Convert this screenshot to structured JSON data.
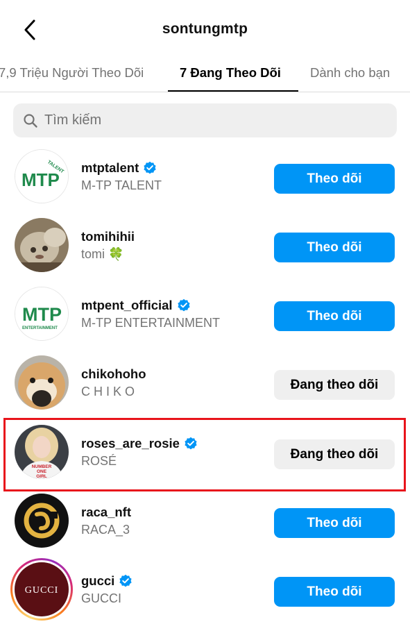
{
  "header": {
    "title": "sontungmtp"
  },
  "tabs": [
    {
      "label": "7,9 Triệu Người Theo Dõi",
      "active": false
    },
    {
      "label": "7 Đang Theo Dõi",
      "active": true
    },
    {
      "label": "Dành cho bạn",
      "active": false
    }
  ],
  "search": {
    "placeholder": "Tìm kiếm",
    "value": ""
  },
  "accounts": [
    {
      "username": "mtptalent",
      "verified": true,
      "full_name": "M-TP TALENT",
      "button": "Theo dõi",
      "state": "follow",
      "avatar": "mtp-talent-logo"
    },
    {
      "username": "tomihihii",
      "verified": false,
      "full_name": "tomi 🍀",
      "button": "Theo dõi",
      "state": "follow",
      "avatar": "cat-photo"
    },
    {
      "username": "mtpent_official",
      "verified": true,
      "full_name": "M-TP ENTERTAINMENT",
      "button": "Theo dõi",
      "state": "follow",
      "avatar": "mtp-entertainment-logo"
    },
    {
      "username": "chikohoho",
      "verified": false,
      "full_name": "C H I K O",
      "button": "Đang theo dõi",
      "state": "following",
      "avatar": "dog-photo"
    },
    {
      "username": "roses_are_rosie",
      "verified": true,
      "full_name": "ROSÉ",
      "button": "Đang theo dõi",
      "state": "following",
      "avatar": "person-photo",
      "highlighted": true
    },
    {
      "username": "raca_nft",
      "verified": false,
      "full_name": "RACA_3",
      "button": "Theo dõi",
      "state": "follow",
      "avatar": "raca-logo"
    },
    {
      "username": "gucci",
      "verified": true,
      "full_name": "GUCCI",
      "button": "Theo dõi",
      "state": "follow",
      "avatar": "gucci-logo",
      "story_ring": true
    }
  ],
  "logos": {
    "mtp_talent": {
      "main": "MTP",
      "sub": "TALENT"
    },
    "mtp_entertainment": {
      "main": "MTP",
      "sub": "ENTERTAINMENT"
    },
    "gucci": "GUCCI",
    "rose_shirt": [
      "NUMBER",
      "ONE",
      "GIRL"
    ]
  },
  "colors": {
    "follow_button": "#0095f6",
    "following_button": "#efefef",
    "verified_badge": "#0095f6",
    "highlight_box": "#e8141b",
    "secondary_text": "#737373"
  }
}
